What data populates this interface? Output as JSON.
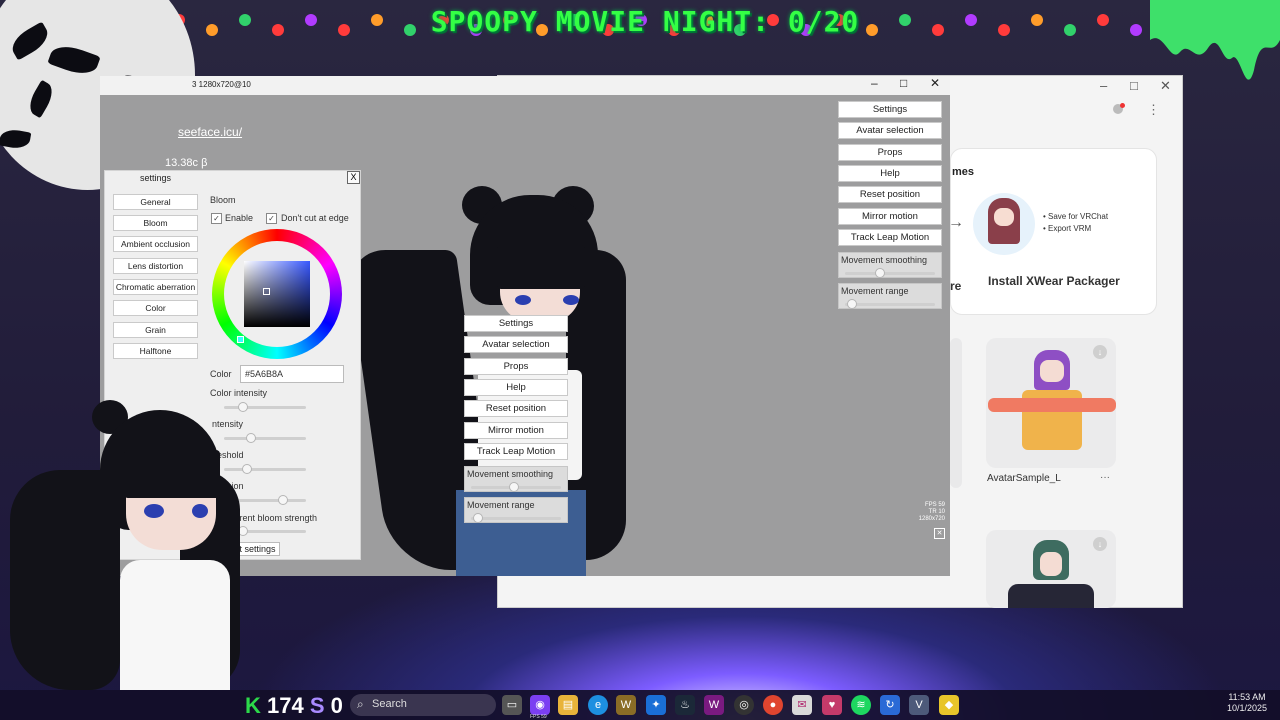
{
  "stream_overlay": {
    "banner_title": "SPOOPY MOVIE NIGHT: 0/20",
    "kill_count": "174",
    "sub_count": "0",
    "kill_icon": "K",
    "sub_icon": "S"
  },
  "vseeface_window": {
    "title_fragment": "3 1280x720@10",
    "link_text": "seeface.icu/",
    "version_text": "13.38c β",
    "fps_overlay": [
      "FPS 59",
      "TR  10",
      "1280x720"
    ],
    "controls": {
      "minimize": "–",
      "maximize": "□",
      "close": "✕"
    }
  },
  "settings_panel": {
    "title": "settings",
    "close_label": "X",
    "tabs": [
      "General",
      "Bloom",
      "Ambient occlusion",
      "Lens distortion",
      "Chromatic aberration",
      "Color",
      "Grain",
      "Halftone"
    ],
    "section_title": "Bloom",
    "enable_label": "Enable",
    "enable_checked": true,
    "dont_cut_label": "Don't cut at edge",
    "dont_cut_checked": true,
    "color_label": "Color",
    "color_value": "#5A6B8A",
    "sliders": [
      {
        "label": "Color intensity",
        "value": 0.2
      },
      {
        "label": "ntensity",
        "value": 0.3
      },
      {
        "label": "reshold",
        "value": 0.25
      },
      {
        "label": "usion",
        "value": 0.75
      },
      {
        "label": "ransparent bloom strength",
        "value": 0.2
      }
    ],
    "reset_label": "Reset settings"
  },
  "right_menu": {
    "buttons": [
      "Settings",
      "Avatar selection",
      "Props",
      "Help",
      "Reset position",
      "Mirror motion",
      "Track Leap Motion"
    ],
    "movement_smoothing_label": "Movement smoothing",
    "movement_smoothing_value": 0.4,
    "movement_range_label": "Movement range",
    "movement_range_value": 0.05
  },
  "center_menu": {
    "buttons": [
      "Settings",
      "Avatar selection",
      "Props",
      "Help",
      "Reset position",
      "Mirror motion",
      "Track Leap Motion"
    ],
    "movement_smoothing_label": "Movement smoothing",
    "movement_smoothing_value": 0.5,
    "movement_range_label": "Movement range",
    "movement_range_value": 0.05
  },
  "xwear_app": {
    "card_heading_fragment": "mes",
    "bullet_1": "• Save for VRChat",
    "bullet_2": "• Export VRM",
    "left_button_fragment": "re",
    "install_button": "Install XWear Packager",
    "avatar_name": "AvatarSample_L",
    "more_label": "···",
    "controls": {
      "minimize": "–",
      "maximize": "□",
      "close": "✕"
    }
  },
  "taskbar": {
    "search_placeholder": "Search",
    "fps_badge": "FPS 59",
    "time": "11:53 AM",
    "date": "10/1/2025"
  },
  "colors": {
    "banner_green": "#34ff45",
    "bloom_color": "#5A6B8A",
    "hair": "#121218",
    "accent_purple": "#7c5cff"
  }
}
